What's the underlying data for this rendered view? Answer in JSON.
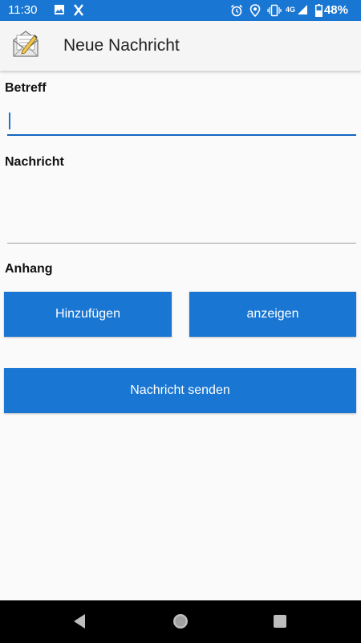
{
  "status_bar": {
    "time": "11:30",
    "network": "4G",
    "battery": "48%",
    "icons": [
      "image-icon",
      "x-app-icon",
      "alarm-icon",
      "location-icon",
      "vibrate-icon",
      "signal-icon",
      "battery-icon"
    ]
  },
  "app_bar": {
    "title": "Neue Nachricht",
    "icon": "mail-edit-icon"
  },
  "form": {
    "subject_label": "Betreff",
    "subject_value": "",
    "message_label": "Nachricht",
    "message_value": "",
    "attachment_label": "Anhang",
    "add_button": "Hinzufügen",
    "show_button": "anzeigen",
    "send_button": "Nachricht senden"
  },
  "colors": {
    "accent": "#1976d2",
    "background": "#fafafa",
    "navbar": "#000000"
  },
  "nav_bar": {
    "icons": [
      "back-icon",
      "home-icon",
      "recents-icon"
    ]
  }
}
